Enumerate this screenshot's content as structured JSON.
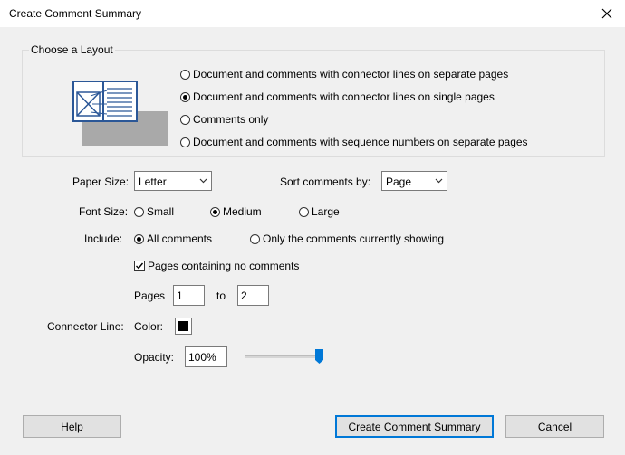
{
  "window": {
    "title": "Create Comment Summary"
  },
  "layout": {
    "group_label": "Choose a Layout",
    "options": [
      {
        "label": "Document and comments with connector lines on separate pages",
        "selected": false
      },
      {
        "label": "Document and comments with connector lines on single pages",
        "selected": true
      },
      {
        "label": "Comments only",
        "selected": false
      },
      {
        "label": "Document and comments with sequence numbers on separate pages",
        "selected": false
      }
    ]
  },
  "paper_size": {
    "label": "Paper Size:",
    "value": "Letter"
  },
  "sort": {
    "label": "Sort comments by:",
    "value": "Page"
  },
  "font_size": {
    "label": "Font Size:",
    "options": [
      {
        "label": "Small",
        "selected": false
      },
      {
        "label": "Medium",
        "selected": true
      },
      {
        "label": "Large",
        "selected": false
      }
    ]
  },
  "include": {
    "label": "Include:",
    "options": [
      {
        "label": "All comments",
        "selected": true
      },
      {
        "label": "Only the comments currently showing",
        "selected": false
      }
    ]
  },
  "no_comments_pages": {
    "label": "Pages containing no comments",
    "checked": true
  },
  "pages": {
    "label": "Pages",
    "from": "1",
    "to_label": "to",
    "to": "2"
  },
  "connector_line": {
    "label": "Connector Line:",
    "color_label": "Color:",
    "color": "#000000",
    "opacity_label": "Opacity:",
    "opacity_value": "100%",
    "opacity_level": 1.0
  },
  "buttons": {
    "help": "Help",
    "create": "Create Comment Summary",
    "cancel": "Cancel"
  },
  "colors": {
    "accent": "#0078d7"
  }
}
